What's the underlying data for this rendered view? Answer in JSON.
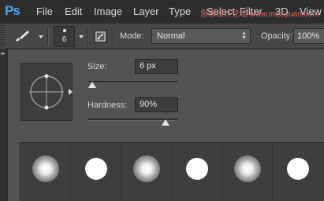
{
  "app": {
    "logo": "Ps"
  },
  "menu": {
    "items": [
      "File",
      "Edit",
      "Image",
      "Layer",
      "Type",
      "Select",
      "Filter",
      "3D",
      "View"
    ],
    "watermark": "思缘设计论坛 www.missyuan.com"
  },
  "options_bar": {
    "brush_size": "6",
    "mode_label": "Mode:",
    "mode_value": "Normal",
    "opacity_label": "Opacity:",
    "opacity_value": "100%"
  },
  "brush_picker": {
    "size_label": "Size:",
    "size_value": "6 px",
    "size_slider_fraction": 0.01,
    "hardness_label": "Hardness:",
    "hardness_value": "90%",
    "hardness_slider_fraction": 0.9,
    "presets": [
      {
        "type": "soft"
      },
      {
        "type": "hard"
      },
      {
        "type": "soft"
      },
      {
        "type": "hard"
      },
      {
        "type": "soft"
      },
      {
        "type": "hard"
      }
    ]
  },
  "colors": {
    "logo_blue": "#4aa6f0",
    "watermark_red": "#e8685e"
  }
}
